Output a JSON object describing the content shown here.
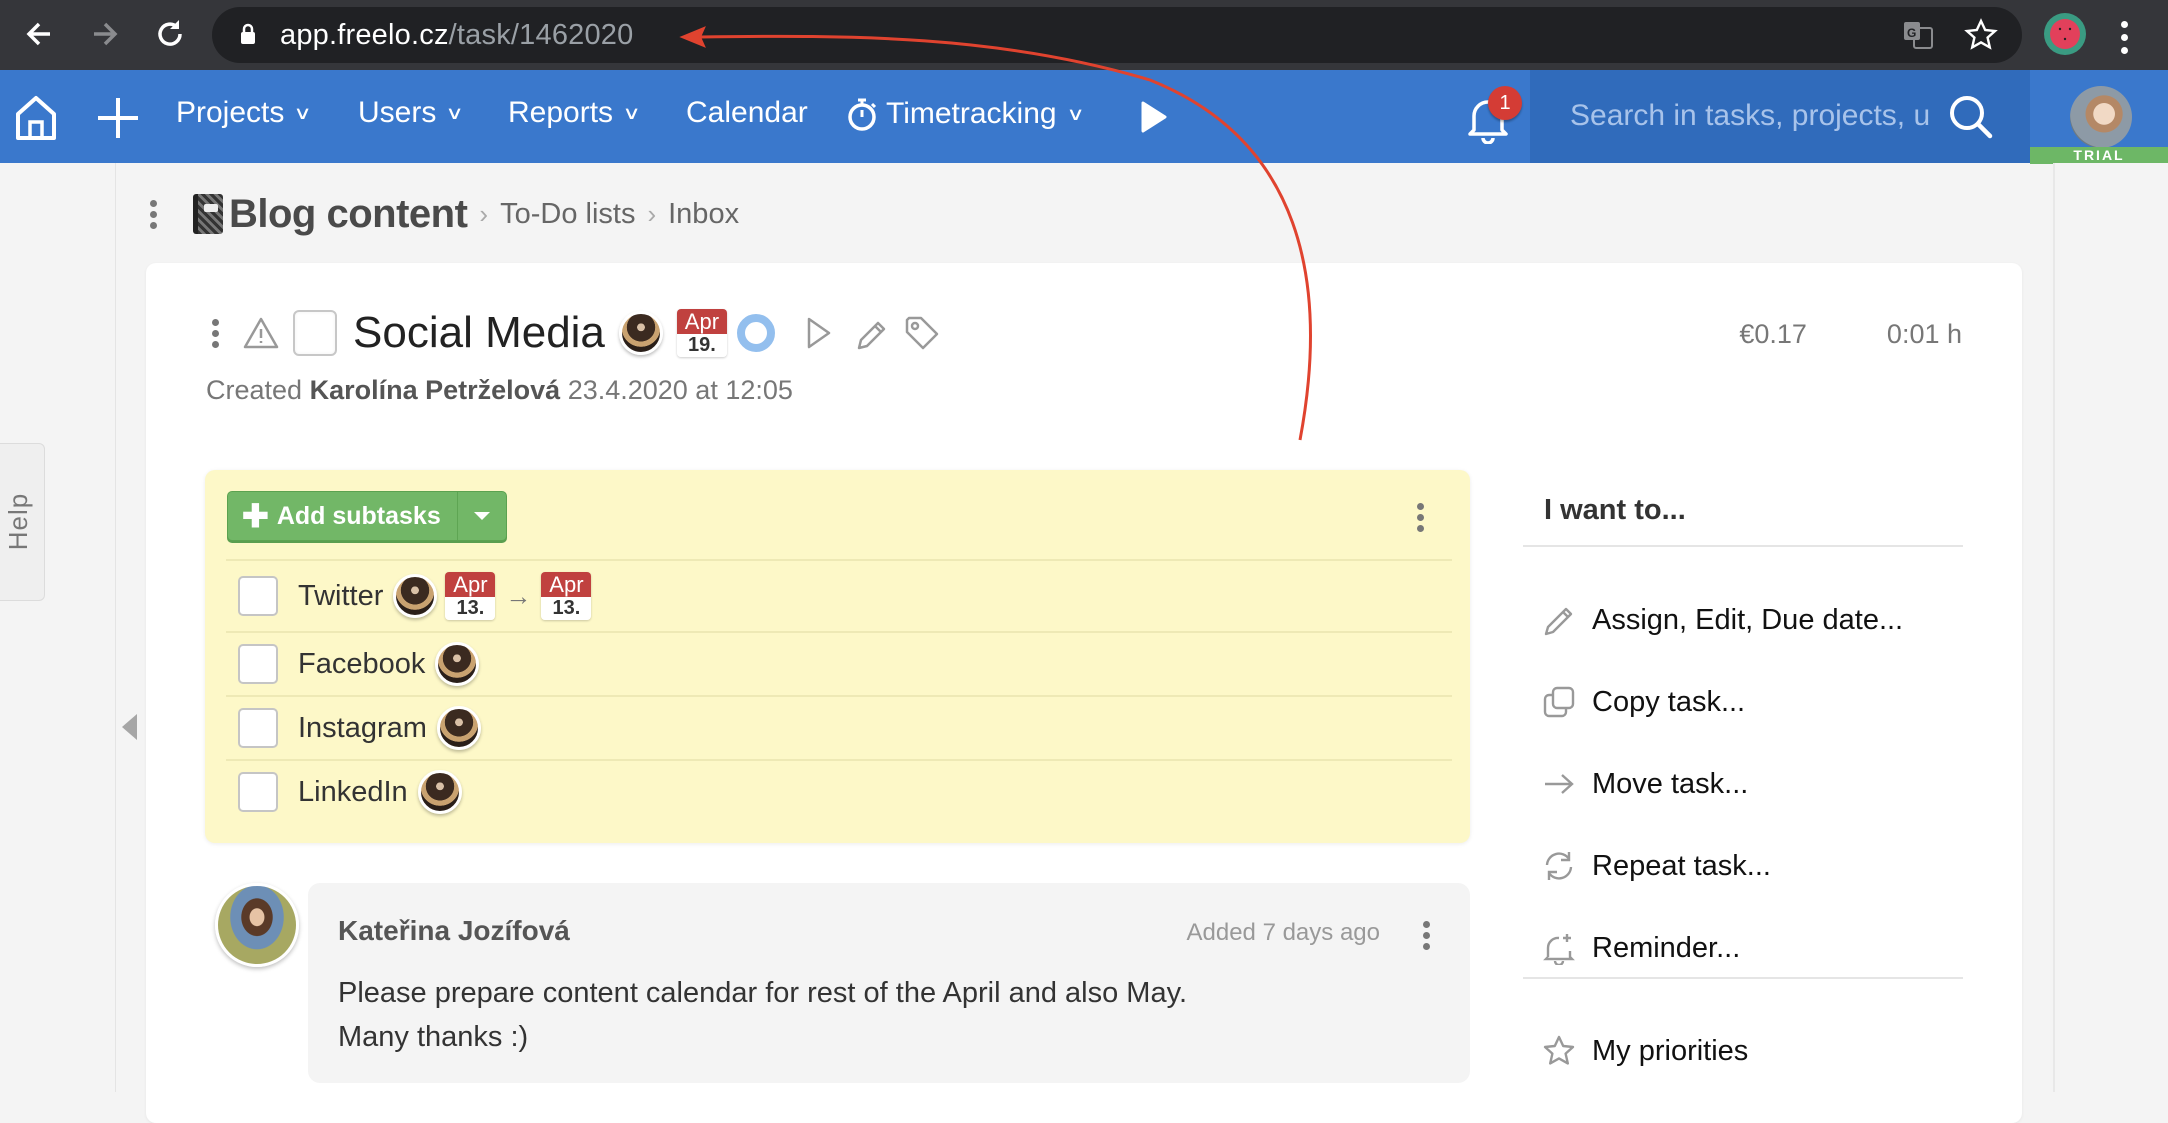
{
  "browser": {
    "url_host": "app.freelo.cz",
    "url_path": "/task/1462020"
  },
  "nav": {
    "items": [
      {
        "label": "Projects",
        "dropdown": true
      },
      {
        "label": "Users",
        "dropdown": true
      },
      {
        "label": "Reports",
        "dropdown": true
      },
      {
        "label": "Calendar",
        "dropdown": false
      },
      {
        "label": "Timetracking",
        "dropdown": true
      }
    ],
    "notification_count": "1",
    "search_placeholder": "Search in tasks, projects, u",
    "trial_label": "TRIAL"
  },
  "sidebar": {
    "help_label": "Help"
  },
  "breadcrumb": {
    "project": "Blog content",
    "items": [
      "To-Do lists",
      "Inbox"
    ]
  },
  "task": {
    "title": "Social Media",
    "due": {
      "month": "Apr",
      "day": "19."
    },
    "cost": "€0.17",
    "time": "0:01 h",
    "created_prefix": "Created",
    "created_by": "Karolína Petrželová",
    "created_at": "23.4.2020 at 12:05"
  },
  "subtasks": {
    "add_label": "Add subtasks",
    "items": [
      {
        "name": "Twitter",
        "start": {
          "month": "Apr",
          "day": "13."
        },
        "end": {
          "month": "Apr",
          "day": "13."
        }
      },
      {
        "name": "Facebook"
      },
      {
        "name": "Instagram"
      },
      {
        "name": "LinkedIn"
      }
    ]
  },
  "actions": {
    "title": "I want to...",
    "items": [
      {
        "label": "Assign, Edit, Due date...",
        "icon": "pencil-icon"
      },
      {
        "label": "Copy task...",
        "icon": "copy-icon"
      },
      {
        "label": "Move task...",
        "icon": "arrow-right-icon"
      },
      {
        "label": "Repeat task...",
        "icon": "repeat-icon"
      },
      {
        "label": "Reminder...",
        "icon": "bell-plus-icon"
      }
    ],
    "priorities_label": "My priorities"
  },
  "comment": {
    "author": "Kateřina Jozífová",
    "time": "Added 7 days ago",
    "lines": [
      "Please prepare content calendar for rest of the April and also May.",
      "Many thanks :)"
    ]
  },
  "colors": {
    "nav_blue": "#3a78cc",
    "search_blue": "#306bbb",
    "trial_green": "#6db766",
    "add_button_green": "#72b767",
    "subtask_yellow": "#fdf8c8",
    "date_red": "#c0413f",
    "annotation_red": "#e0432f"
  }
}
